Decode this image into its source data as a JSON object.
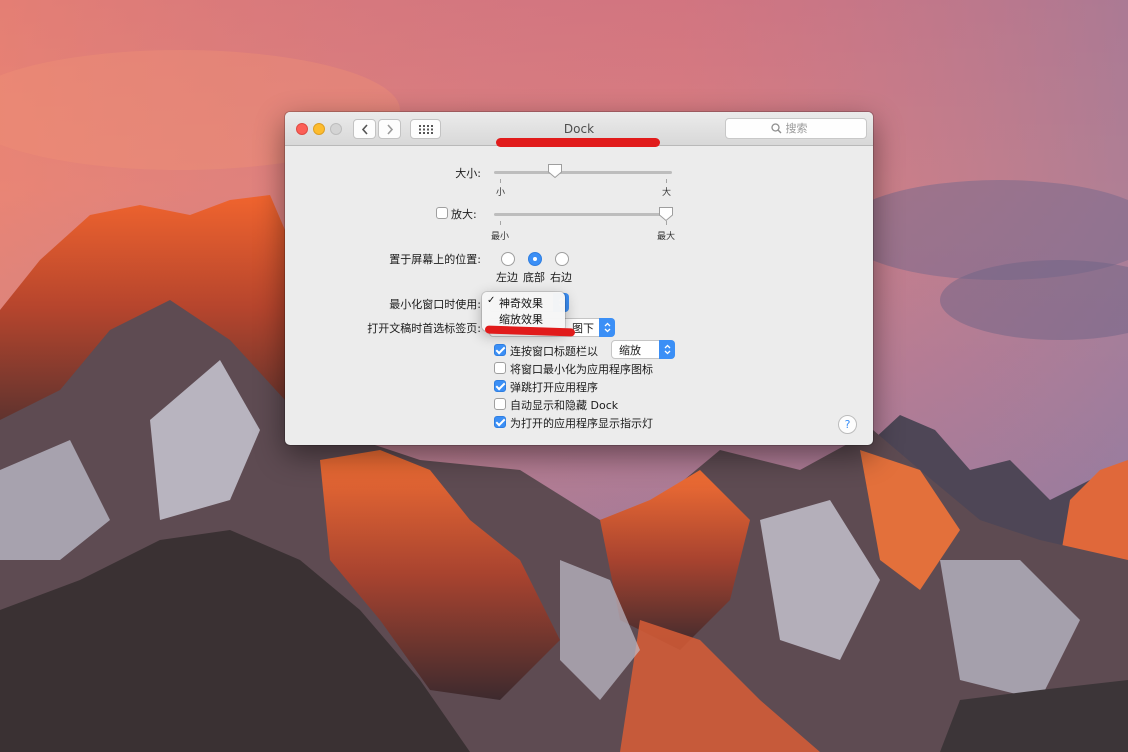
{
  "window": {
    "title": "Dock",
    "search_placeholder": "搜索"
  },
  "size": {
    "label": "大小:",
    "min_label": "小",
    "max_label": "大",
    "value": 0.33
  },
  "magnification": {
    "label": "放大:",
    "checked": false,
    "min_label": "最小",
    "max_label": "最大",
    "value": 1.0
  },
  "position": {
    "label": "置于屏幕上的位置:",
    "options": [
      "左边",
      "底部",
      "右边"
    ],
    "selected": "底部"
  },
  "minimize_effect": {
    "label": "最小化窗口时使用:",
    "menu_items": [
      "神奇效果",
      "缩放效果"
    ],
    "selected": "神奇效果"
  },
  "tabs_preference": {
    "label": "打开文稿时首选标签页:",
    "value_visible": "图下"
  },
  "checkboxes": [
    {
      "label": "连按窗口标题栏以",
      "checked": true
    },
    {
      "label": "将窗口最小化为应用程序图标",
      "checked": false
    },
    {
      "label": "弹跳打开应用程序",
      "checked": true
    },
    {
      "label": "自动显示和隐藏 Dock",
      "checked": false
    },
    {
      "label": "为打开的应用程序显示指示灯",
      "checked": true
    }
  ],
  "double_click_action": {
    "value": "缩放"
  },
  "help": {
    "label": "?"
  },
  "colors": {
    "accent": "#3b8ff6",
    "annotation_red": "#e11b1b",
    "window_bg": "#ececec"
  },
  "icons": {
    "back": "chevron-left-icon",
    "forward": "chevron-right-icon",
    "show_all": "grid-icon",
    "search": "magnifier-icon",
    "popup_arrows": "up-down-arrows-icon",
    "checkmark": "checkmark-icon"
  }
}
